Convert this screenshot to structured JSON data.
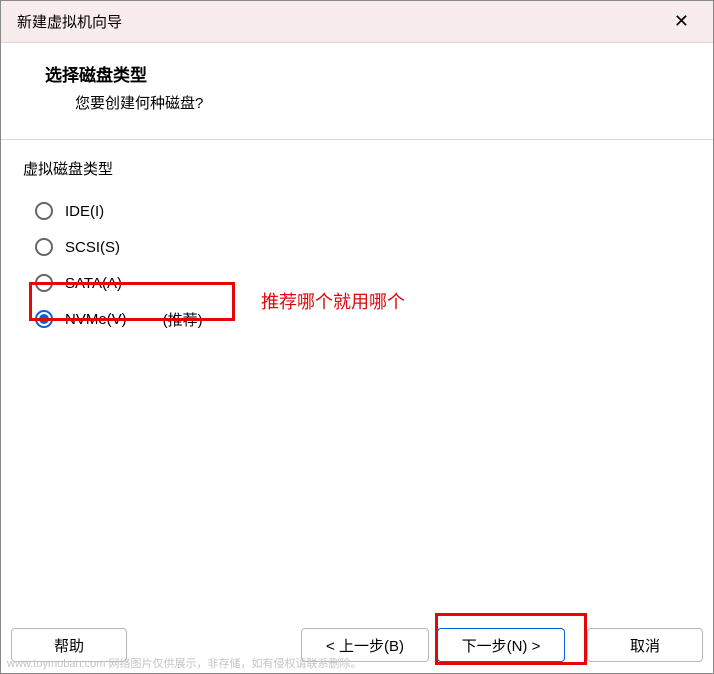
{
  "title_bar": {
    "title": "新建虚拟机向导"
  },
  "header": {
    "title": "选择磁盘类型",
    "desc": "您要创建何种磁盘?"
  },
  "group_label": "虚拟磁盘类型",
  "options": [
    {
      "label": "IDE(I)",
      "selected": false,
      "recommend": ""
    },
    {
      "label": "SCSI(S)",
      "selected": false,
      "recommend": ""
    },
    {
      "label": "SATA(A)",
      "selected": false,
      "recommend": ""
    },
    {
      "label": "NVMe(V)",
      "selected": true,
      "recommend": "(推荐)"
    }
  ],
  "annotation": "推荐哪个就用哪个",
  "buttons": {
    "help": "帮助",
    "prev": "< 上一步(B)",
    "next": "下一步(N) >",
    "cancel": "取消"
  },
  "watermark": "www.toymoban.com 网络图片仅供展示，非存储，如有侵权请联系删除。"
}
